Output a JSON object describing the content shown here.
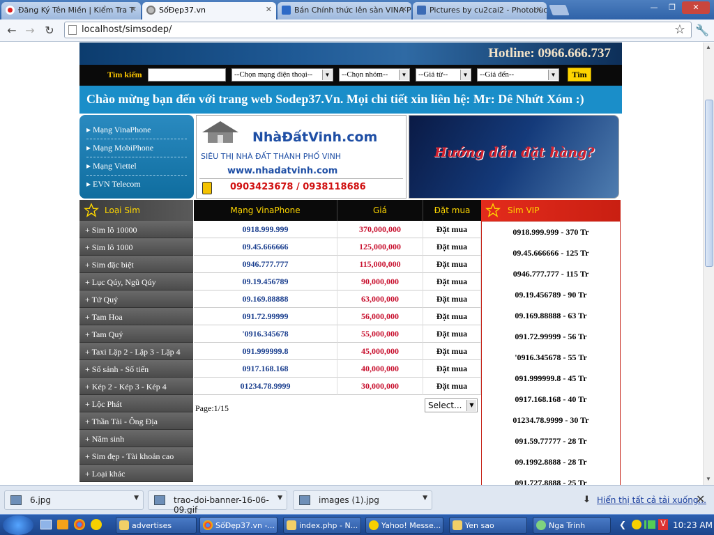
{
  "browser": {
    "tabs": [
      {
        "title": "Đăng Ký Tên Miền | Kiểm Tra T",
        "active": false
      },
      {
        "title": "SốĐẹp37.vn",
        "active": true
      },
      {
        "title": "Bán Chính thức lên sàn VINA P",
        "active": false
      },
      {
        "title": "Pictures by cu2cai2 - Photobuc",
        "active": false
      }
    ],
    "url": "localhost/simsodep/"
  },
  "site": {
    "hotline": "Hotline: 0966.666.737",
    "search": {
      "label": "Tìm kiếm",
      "network_select": "--Chọn mạng điện thoại--",
      "group_select": "--Chọn nhóm--",
      "price_from_select": "--Giá từ--",
      "price_to_select": "--Giá đến--",
      "button": "Tìm"
    },
    "welcome": "Chào mừng bạn đến với trang web Sodep37.Vn. Mọi chi tiết xin liên hệ: Mr: Dê Nhứt Xóm :)",
    "networks": [
      "Mạng VinaPhone",
      "Mạng MobiPhone",
      "Mạng Viettel",
      "EVN Telecom"
    ],
    "ad1": {
      "brand": "NhàĐấtVinh.com",
      "tagline": "SIÊU THỊ NHÀ ĐẤT THÀNH PHỐ VINH",
      "url": "www.nhadatvinh.com",
      "phone": "0903423678 / 0938118686"
    },
    "ad2": {
      "text": "Hướng dẫn đặt hàng?"
    },
    "sidebar": {
      "title": "Loại Sim",
      "categories": [
        "Sim lô 10000",
        "Sim lô 1000",
        "Sim đặc biệt",
        "Lục Qúy, Ngũ Qúy",
        "Tứ Quý",
        "Tam Hoa",
        "Tam Quý",
        "Taxi Lặp 2 - Lặp 3 - Lặp 4",
        "Số sảnh - Số tiến",
        "Kép 2 - Kép 3 - Kép 4",
        "Lộc Phát",
        "Thần Tài - Ông Địa",
        "Năm sinh",
        "Sim đẹp - Tài khoản cao",
        "Loại khác"
      ]
    },
    "table": {
      "headers": {
        "number": "Mạng VinaPhone",
        "price": "Giá",
        "buy": "Đặt mua"
      },
      "rows": [
        {
          "number": "0918.999.999",
          "price": "370,000,000",
          "buy": "Đặt mua"
        },
        {
          "number": "09.45.666666",
          "price": "125,000,000",
          "buy": "Đặt mua"
        },
        {
          "number": "0946.777.777",
          "price": "115,000,000",
          "buy": "Đặt mua"
        },
        {
          "number": "09.19.456789",
          "price": "90,000,000",
          "buy": "Đặt mua"
        },
        {
          "number": "09.169.88888",
          "price": "63,000,000",
          "buy": "Đặt mua"
        },
        {
          "number": "091.72.99999",
          "price": "56,000,000",
          "buy": "Đặt mua"
        },
        {
          "number": "'0916.345678",
          "price": "55,000,000",
          "buy": "Đặt mua"
        },
        {
          "number": "091.999999.8",
          "price": "45,000,000",
          "buy": "Đặt mua"
        },
        {
          "number": "0917.168.168",
          "price": "40,000,000",
          "buy": "Đặt mua"
        },
        {
          "number": "01234.78.9999",
          "price": "30,000,000",
          "buy": "Đặt mua"
        }
      ],
      "page_info": "Page:1/15",
      "page_select": "Select..."
    },
    "vip": {
      "title": "Sim VIP",
      "items": [
        "0918.999.999 - 370 Tr",
        "09.45.666666 - 125 Tr",
        "0946.777.777 - 115 Tr",
        "09.19.456789 - 90 Tr",
        "09.169.88888 - 63 Tr",
        "091.72.99999 - 56 Tr",
        "'0916.345678 - 55 Tr",
        "091.999999.8 - 45 Tr",
        "0917.168.168 - 40 Tr",
        "01234.78.9999 - 30 Tr",
        "091.59.77777 - 28 Tr",
        "09.1992.8888 - 28 Tr",
        "091.727.8888 - 25 Tr"
      ]
    }
  },
  "downloads": {
    "items": [
      "6.jpg",
      "trao-doi-banner-16-06-09.gif",
      "images (1).jpg"
    ],
    "show_all": "Hiển thị tất cả tải xuống..."
  },
  "taskbar": {
    "items": [
      "advertises",
      "SốĐẹp37.vn -...",
      "index.php - N...",
      "Yahoo! Messe...",
      "Yen sao",
      "Nga Trinh"
    ],
    "clock": "10:23 AM"
  },
  "colors": {
    "accent_blue": "#1a8ec9",
    "price_red": "#c8102e",
    "vip_red": "#e32b1c",
    "search_yellow": "#ffd400"
  }
}
